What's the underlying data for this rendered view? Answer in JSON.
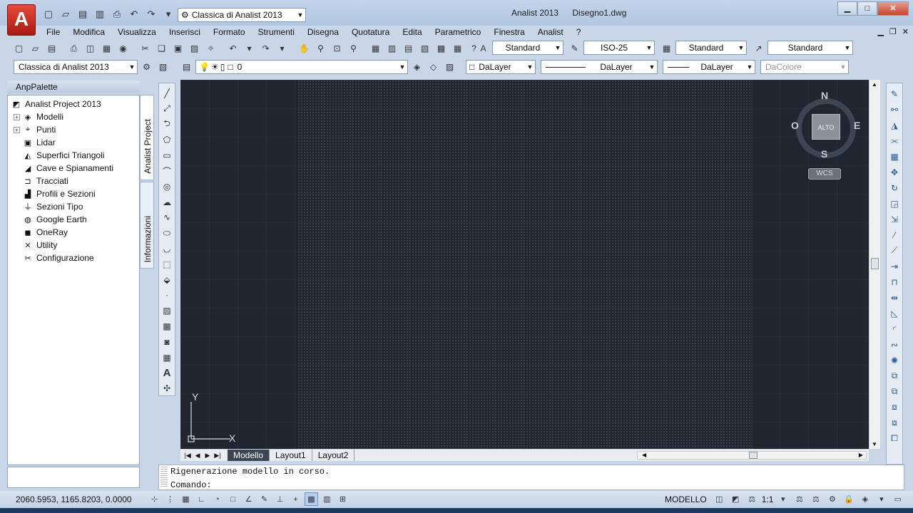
{
  "app": {
    "logo_letter": "A",
    "workspace": "Classica di Analist 2013",
    "product": "Analist 2013",
    "document": "Disegno1.dwg"
  },
  "menu": [
    "File",
    "Modifica",
    "Visualizza",
    "Inserisci",
    "Formato",
    "Strumenti",
    "Disegna",
    "Quotatura",
    "Edita",
    "Parametrico",
    "Finestra",
    "Analist",
    "?"
  ],
  "toolbar_styles": {
    "text_style": "Standard",
    "dim_style": "ISO-25",
    "table_style": "Standard",
    "mleader_style": "Standard"
  },
  "toolbar_layers": {
    "workspace": "Classica di Analist 2013",
    "layer": "0",
    "color": "DaLayer",
    "linetype": "DaLayer",
    "lineweight": "DaLayer",
    "plotstyle": "DaColore"
  },
  "palette": {
    "title": "AnpPalette",
    "root": "Analist Project 2013",
    "items": [
      {
        "label": "Modelli",
        "expandable": true,
        "icon": "models-icon",
        "glyph": "◈"
      },
      {
        "label": "Punti",
        "expandable": true,
        "icon": "points-icon",
        "glyph": "⌖"
      },
      {
        "label": "Lidar",
        "expandable": false,
        "icon": "lidar-icon",
        "glyph": "▣"
      },
      {
        "label": "Superfici Triangoli",
        "expandable": false,
        "icon": "surface-icon",
        "glyph": "◭"
      },
      {
        "label": "Cave e Spianamenti",
        "expandable": false,
        "icon": "quarry-icon",
        "glyph": "◢"
      },
      {
        "label": "Tracciati",
        "expandable": false,
        "icon": "path-icon",
        "glyph": "⊐"
      },
      {
        "label": "Profili e Sezioni",
        "expandable": false,
        "icon": "profile-icon",
        "glyph": "▟"
      },
      {
        "label": "Sezioni Tipo",
        "expandable": false,
        "icon": "section-icon",
        "glyph": "⏚"
      },
      {
        "label": "Google Earth",
        "expandable": false,
        "icon": "globe-icon",
        "glyph": "◍"
      },
      {
        "label": "OneRay",
        "expandable": false,
        "icon": "oneray-icon",
        "glyph": "◼"
      },
      {
        "label": "Utility",
        "expandable": false,
        "icon": "utility-icon",
        "glyph": "✕"
      },
      {
        "label": "Configurazione",
        "expandable": false,
        "icon": "config-icon",
        "glyph": "✂"
      }
    ],
    "tabs": [
      "Analist Project",
      "Informazioni"
    ]
  },
  "viewcube": {
    "face": "ALTO",
    "north": "N",
    "south": "S",
    "east": "E",
    "west": "O",
    "ucs_button": "WCS"
  },
  "ucs_axes": {
    "x": "X",
    "y": "Y"
  },
  "layout_tabs": [
    "Modello",
    "Layout1",
    "Layout2"
  ],
  "command": {
    "history": "Rigenerazione modello in corso.",
    "prompt": "Comando:"
  },
  "status": {
    "coords": "2060.5953, 1165.8203, 0.0000",
    "space": "MODELLO",
    "scale": "1:1"
  },
  "colors": {
    "canvas": "#1f2630",
    "accent": "#c8432c"
  }
}
